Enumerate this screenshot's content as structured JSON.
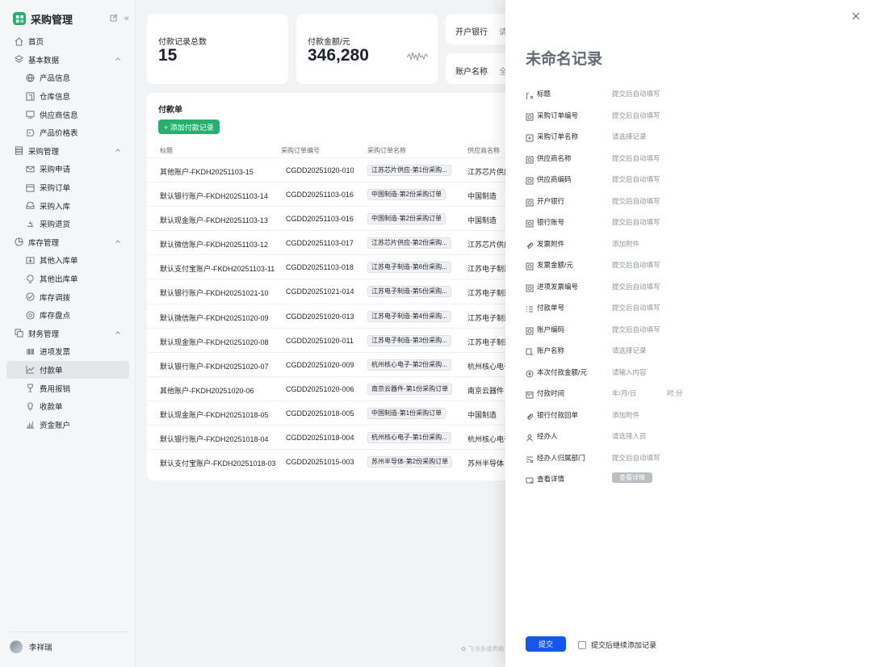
{
  "sidebar": {
    "brand": "采购管理",
    "items": [
      {
        "label": "首页",
        "level": 0,
        "icon": "home-icon"
      },
      {
        "label": "基本数据",
        "level": 0,
        "icon": "layers-icon",
        "expanded": true
      },
      {
        "label": "产品信息",
        "level": 1,
        "icon": "globe-icon"
      },
      {
        "label": "仓库信息",
        "level": 1,
        "icon": "warehouse-icon"
      },
      {
        "label": "供应商信息",
        "level": 1,
        "icon": "monitor-icon"
      },
      {
        "label": "产品价格表",
        "level": 1,
        "icon": "price-icon"
      },
      {
        "label": "采购管理",
        "level": 0,
        "icon": "database-icon",
        "expanded": true
      },
      {
        "label": "采购申请",
        "level": 1,
        "icon": "mail-icon"
      },
      {
        "label": "采购订单",
        "level": 1,
        "icon": "calendar-icon"
      },
      {
        "label": "采购入库",
        "level": 1,
        "icon": "inbox-icon"
      },
      {
        "label": "采购退货",
        "level": 1,
        "icon": "return-icon"
      },
      {
        "label": "库存管理",
        "level": 0,
        "icon": "pie-icon",
        "expanded": true
      },
      {
        "label": "其他入库单",
        "level": 1,
        "icon": "stock-in-icon"
      },
      {
        "label": "其他出库单",
        "level": 1,
        "icon": "stock-out-icon"
      },
      {
        "label": "库存调拨",
        "level": 1,
        "icon": "transfer-icon"
      },
      {
        "label": "库存盘点",
        "level": 1,
        "icon": "count-icon"
      },
      {
        "label": "财务管理",
        "level": 0,
        "icon": "copy-icon",
        "expanded": true
      },
      {
        "label": "进项发票",
        "level": 1,
        "icon": "barcode-icon"
      },
      {
        "label": "付款单",
        "level": 1,
        "icon": "area-chart-icon",
        "active": true
      },
      {
        "label": "费用报销",
        "level": 1,
        "icon": "trophy-icon"
      },
      {
        "label": "收款单",
        "level": 1,
        "icon": "bulb-icon"
      },
      {
        "label": "资金账户",
        "level": 1,
        "icon": "bar-chart-icon"
      }
    ],
    "user": "李祥瑞"
  },
  "stats": [
    {
      "label": "付款记录总数",
      "value": "15"
    },
    {
      "label": "付款金额/元",
      "value": "346,280"
    }
  ],
  "filters": [
    {
      "label": "开户银行",
      "placeholder": "请"
    },
    {
      "label": "账户名称",
      "placeholder": "全"
    }
  ],
  "table": {
    "title": "付款单",
    "add_label": "+ 添加付款记录",
    "columns": [
      "标题",
      "采购订单编号",
      "采购订单名称",
      "供应商名称"
    ],
    "rows": [
      {
        "title": "其他账户-FKDH20251103-15",
        "order_no": "CGDD20251020-010",
        "order_name": "江苏芯片供应-第1份采购...",
        "supplier": "江苏芯片供应"
      },
      {
        "title": "默认银行账户-FKDH20251103-14",
        "order_no": "CGDD20251103-016",
        "order_name": "中国制造-第2份采购订单",
        "supplier": "中国制造"
      },
      {
        "title": "默认现金账户-FKDH20251103-13",
        "order_no": "CGDD20251103-016",
        "order_name": "中国制造-第2份采购订单",
        "supplier": "中国制造"
      },
      {
        "title": "默认微信账户-FKDH20251103-12",
        "order_no": "CGDD20251103-017",
        "order_name": "江苏芯片供应-第2份采购...",
        "supplier": "江苏芯片供应"
      },
      {
        "title": "默认支付宝账户-FKDH20251103-11",
        "order_no": "CGDD20251103-018",
        "order_name": "江苏电子制造-第6份采购...",
        "supplier": "江苏电子制造"
      },
      {
        "title": "默认银行账户-FKDH20251021-10",
        "order_no": "CGDD20251021-014",
        "order_name": "江苏电子制造-第5份采购...",
        "supplier": "江苏电子制造"
      },
      {
        "title": "默认微信账户-FKDH20251020-09",
        "order_no": "CGDD20251020-013",
        "order_name": "江苏电子制造-第4份采购...",
        "supplier": "江苏电子制造"
      },
      {
        "title": "默认现金账户-FKDH20251020-08",
        "order_no": "CGDD20251020-011",
        "order_name": "江苏电子制造-第3份采购...",
        "supplier": "江苏电子制造"
      },
      {
        "title": "默认银行账户-FKDH20251020-07",
        "order_no": "CGDD20251020-009",
        "order_name": "杭州核心电子-第2份采购...",
        "supplier": "杭州核心电子"
      },
      {
        "title": "其他账户-FKDH20251020-06",
        "order_no": "CGDD20251020-006",
        "order_name": "南京云器件-第1份采购订单",
        "supplier": "南京云器件"
      },
      {
        "title": "默认现金账户-FKDH20251018-05",
        "order_no": "CGDD20251018-005",
        "order_name": "中国制造-第1份采购订单",
        "supplier": "中国制造"
      },
      {
        "title": "默认银行账户-FKDH20251018-04",
        "order_no": "CGDD20251018-004",
        "order_name": "杭州核心电子-第1份采购...",
        "supplier": "杭州核心电子"
      },
      {
        "title": "默认支付宝账户-FKDH20251018-03",
        "order_no": "CGDD20251015-003",
        "order_name": "苏州半导体-第2份采购订单",
        "supplier": "苏州半导体"
      }
    ]
  },
  "footer_note": "飞书多维表格",
  "drawer": {
    "title": "未命名记录",
    "fields": [
      {
        "label": "标题",
        "value": "提交后自动填写",
        "icon": "formula-icon"
      },
      {
        "label": "采购订单编号",
        "value": "提交后自动填写",
        "icon": "lookup-icon"
      },
      {
        "label": "采购订单名称",
        "value": "请选择记录",
        "icon": "link-record-icon"
      },
      {
        "label": "供应商名称",
        "value": "提交后自动填写",
        "icon": "lookup-icon"
      },
      {
        "label": "供应商编码",
        "value": "提交后自动填写",
        "icon": "lookup-icon"
      },
      {
        "label": "开户银行",
        "value": "提交后自动填写",
        "icon": "lookup-icon"
      },
      {
        "label": "银行账号",
        "value": "提交后自动填写",
        "icon": "lookup-icon"
      },
      {
        "label": "发票附件",
        "value": "添加附件",
        "icon": "attachment-icon"
      },
      {
        "label": "发票金额/元",
        "value": "提交后自动填写",
        "icon": "lookup-icon"
      },
      {
        "label": "进项发票编号",
        "value": "提交后自动填写",
        "icon": "lookup-icon"
      },
      {
        "label": "付款单号",
        "value": "提交后自动填写",
        "icon": "autonumber-icon"
      },
      {
        "label": "账户编码",
        "value": "提交后自动填写",
        "icon": "lookup-icon"
      },
      {
        "label": "账户名称",
        "value": "请选择记录",
        "icon": "two-way-link-icon"
      },
      {
        "label": "本次付款金额/元",
        "value": "请输入内容",
        "icon": "currency-icon"
      },
      {
        "label": "付款时间",
        "value": "年/月/日",
        "value2": "时:分",
        "icon": "date-icon"
      },
      {
        "label": "银行付款回单",
        "value": "添加附件",
        "icon": "attachment-icon"
      },
      {
        "label": "经办人",
        "value": "请选择人员",
        "icon": "person-icon"
      },
      {
        "label": "经办人归属部门",
        "value": "提交后自动填写",
        "icon": "lookup-list-icon"
      },
      {
        "label": "查看详情",
        "value": "查看详情",
        "icon": "button-field-icon",
        "is_button": true
      }
    ],
    "submit_label": "提交",
    "continue_label": "提交后继续添加记录"
  },
  "colors": {
    "accent_green": "#23b26d",
    "primary_blue": "#1456f0"
  }
}
